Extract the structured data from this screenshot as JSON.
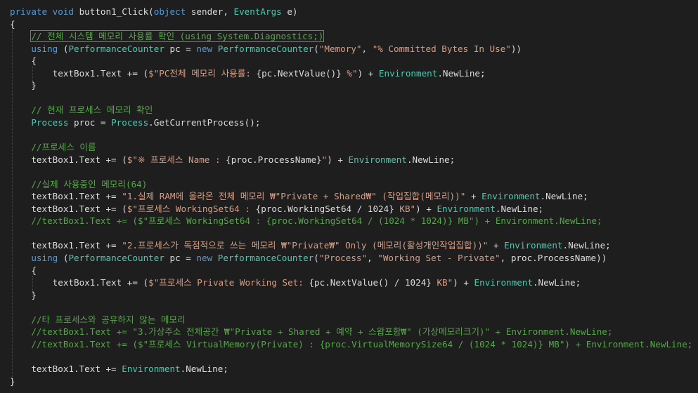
{
  "editor": {
    "lines": [
      [
        {
          "t": "private",
          "c": "kw"
        },
        {
          "t": " "
        },
        {
          "t": "void",
          "c": "kw"
        },
        {
          "t": " button1_Click("
        },
        {
          "t": "object",
          "c": "kw"
        },
        {
          "t": " sender, "
        },
        {
          "t": "EventArgs",
          "c": "ty"
        },
        {
          "t": " e)"
        }
      ],
      [
        {
          "t": "{"
        }
      ],
      [
        {
          "t": "    "
        },
        {
          "t": "// 전체 시스템 메모리 사용률 확인 (using System.Diagnostics;)",
          "c": "cm"
        }
      ],
      [
        {
          "t": "    "
        },
        {
          "t": "using",
          "c": "kw"
        },
        {
          "t": " ("
        },
        {
          "t": "PerformanceCounter",
          "c": "ty"
        },
        {
          "t": " pc = "
        },
        {
          "t": "new",
          "c": "kw"
        },
        {
          "t": " "
        },
        {
          "t": "PerformanceCounter",
          "c": "ty"
        },
        {
          "t": "("
        },
        {
          "t": "\"Memory\"",
          "c": "str"
        },
        {
          "t": ", "
        },
        {
          "t": "\"% Committed Bytes In Use\"",
          "c": "str"
        },
        {
          "t": "))"
        }
      ],
      [
        {
          "t": "    {"
        }
      ],
      [
        {
          "t": "        textBox1.Text += ("
        },
        {
          "t": "$\"PC전체 메모리 사용률: ",
          "c": "str"
        },
        {
          "t": "{pc.NextValue()}"
        },
        {
          "t": " %\"",
          "c": "str"
        },
        {
          "t": ") + "
        },
        {
          "t": "Environment",
          "c": "ty"
        },
        {
          "t": ".NewLine;"
        }
      ],
      [
        {
          "t": "    }"
        }
      ],
      [],
      [
        {
          "t": "    "
        },
        {
          "t": "// 현재 프로세스 메모리 확인",
          "c": "cm"
        }
      ],
      [
        {
          "t": "    "
        },
        {
          "t": "Process",
          "c": "ty"
        },
        {
          "t": " proc = "
        },
        {
          "t": "Process",
          "c": "ty"
        },
        {
          "t": ".GetCurrentProcess();"
        }
      ],
      [],
      [
        {
          "t": "    "
        },
        {
          "t": "//프로세스 이름",
          "c": "cm"
        }
      ],
      [
        {
          "t": "    textBox1.Text += ("
        },
        {
          "t": "$\"※ 프로세스 Name : ",
          "c": "str"
        },
        {
          "t": "{proc.ProcessName}"
        },
        {
          "t": "\"",
          "c": "str"
        },
        {
          "t": ") + "
        },
        {
          "t": "Environment",
          "c": "ty"
        },
        {
          "t": ".NewLine;"
        }
      ],
      [],
      [
        {
          "t": "    "
        },
        {
          "t": "//실제 사용중인 메모리(64)",
          "c": "cm"
        }
      ],
      [
        {
          "t": "    textBox1.Text += "
        },
        {
          "t": "\"1.실제 RAM에 올라온 전체 메모리 ₩\"Private + Shared₩\" (작업집합(메모리))\"",
          "c": "str"
        },
        {
          "t": " + "
        },
        {
          "t": "Environment",
          "c": "ty"
        },
        {
          "t": ".NewLine;"
        }
      ],
      [
        {
          "t": "    textBox1.Text += ("
        },
        {
          "t": "$\"프로세스 WorkingSet64 : ",
          "c": "str"
        },
        {
          "t": "{proc.WorkingSet64 / 1024}"
        },
        {
          "t": " KB\"",
          "c": "str"
        },
        {
          "t": ") + "
        },
        {
          "t": "Environment",
          "c": "ty"
        },
        {
          "t": ".NewLine;"
        }
      ],
      [
        {
          "t": "    "
        },
        {
          "t": "//textBox1.Text += ($\"프로세스 WorkingSet64 : {proc.WorkingSet64 / (1024 * 1024)} MB\") + Environment.NewLine;",
          "c": "cm"
        }
      ],
      [],
      [
        {
          "t": "    textBox1.Text += "
        },
        {
          "t": "\"2.프로세스가 독점적으로 쓰는 메모리 ₩\"Private₩\" Only (메모리(활성개인작업집합))\"",
          "c": "str"
        },
        {
          "t": " + "
        },
        {
          "t": "Environment",
          "c": "ty"
        },
        {
          "t": ".NewLine;"
        }
      ],
      [
        {
          "t": "    "
        },
        {
          "t": "using",
          "c": "kw"
        },
        {
          "t": " ("
        },
        {
          "t": "PerformanceCounter",
          "c": "ty"
        },
        {
          "t": " pc = "
        },
        {
          "t": "new",
          "c": "kw"
        },
        {
          "t": " "
        },
        {
          "t": "PerformanceCounter",
          "c": "ty"
        },
        {
          "t": "("
        },
        {
          "t": "\"Process\"",
          "c": "str"
        },
        {
          "t": ", "
        },
        {
          "t": "\"Working Set - Private\"",
          "c": "str"
        },
        {
          "t": ", proc.ProcessName))"
        }
      ],
      [
        {
          "t": "    {"
        }
      ],
      [
        {
          "t": "        textBox1.Text += ("
        },
        {
          "t": "$\"프로세스 Private Working Set: ",
          "c": "str"
        },
        {
          "t": "{pc.NextValue() / 1024}"
        },
        {
          "t": " KB\"",
          "c": "str"
        },
        {
          "t": ") + "
        },
        {
          "t": "Environment",
          "c": "ty"
        },
        {
          "t": ".NewLine;"
        }
      ],
      [
        {
          "t": "    }"
        }
      ],
      [],
      [
        {
          "t": "    "
        },
        {
          "t": "//타 프로세스와 공유하지 않는 메모리",
          "c": "cm"
        }
      ],
      [
        {
          "t": "    "
        },
        {
          "t": "//textBox1.Text += \"3.가상주소 전체공간 ₩\"Private + Shared + 예약 + 스왑포함₩\" (가상메모리크기)\" + Environment.NewLine;",
          "c": "cm"
        }
      ],
      [
        {
          "t": "    "
        },
        {
          "t": "//textBox1.Text += ($\"프로세스 VirtualMemory(Private) : {proc.VirtualMemorySize64 / (1024 * 1024)} MB\") + Environment.NewLine;",
          "c": "cm"
        }
      ],
      [],
      [
        {
          "t": "    textBox1.Text += "
        },
        {
          "t": "Environment",
          "c": "ty"
        },
        {
          "t": ".NewLine;"
        }
      ],
      [
        {
          "t": "}"
        }
      ]
    ]
  }
}
